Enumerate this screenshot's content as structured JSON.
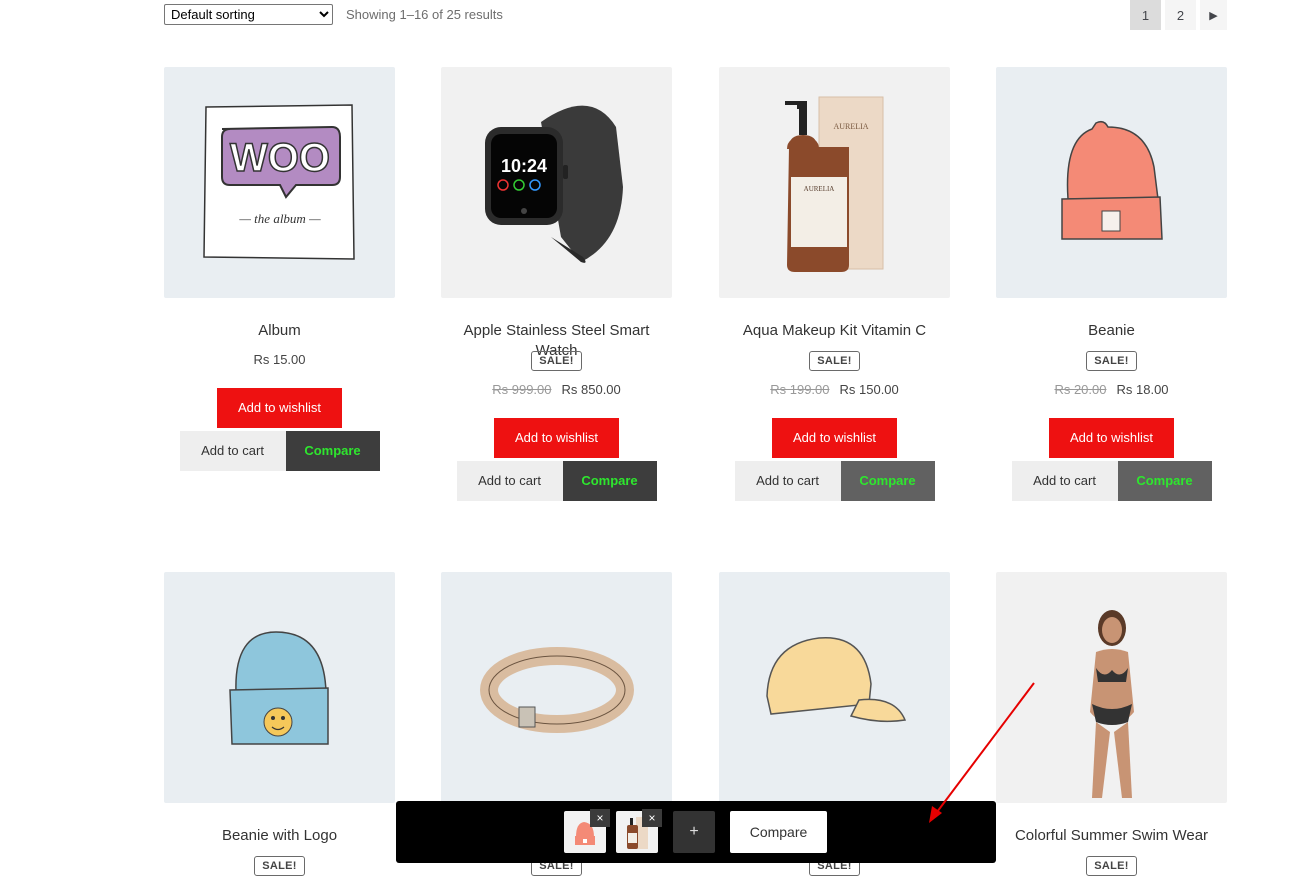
{
  "toolbar": {
    "sort_selected": "Default sorting",
    "result_count": "Showing 1–16 of 25 results",
    "pages": [
      "1",
      "2"
    ],
    "current_page": "1",
    "next_icon": "caret-right-icon"
  },
  "products": [
    {
      "title": "Album",
      "sale": false,
      "price": "Rs 15.00",
      "wishlist": "Add to wishlist",
      "cart": "Add to cart",
      "compare": "Compare"
    },
    {
      "title": "Apple Stainless Steel Smart Watch",
      "sale": true,
      "sale_label": "SALE!",
      "old_price": "Rs 999.00",
      "price": "Rs 850.00",
      "wishlist": "Add to wishlist",
      "cart": "Add to cart",
      "compare": "Compare"
    },
    {
      "title": "Aqua Makeup Kit Vitamin C",
      "sale": true,
      "sale_label": "SALE!",
      "old_price": "Rs 199.00",
      "price": "Rs 150.00",
      "wishlist": "Add to wishlist",
      "cart": "Add to cart",
      "compare": "Compare"
    },
    {
      "title": "Beanie",
      "sale": true,
      "sale_label": "SALE!",
      "old_price": "Rs 20.00",
      "price": "Rs 18.00",
      "wishlist": "Add to wishlist",
      "cart": "Add to cart",
      "compare": "Compare"
    },
    {
      "title": "Beanie with Logo",
      "sale": true,
      "sale_label": "SALE!"
    },
    {
      "title": "",
      "sale": true,
      "sale_label": "SALE!"
    },
    {
      "title": "",
      "sale": true,
      "sale_label": "SALE!"
    },
    {
      "title": "Colorful Summer Swim Wear",
      "sale": true,
      "sale_label": "SALE!"
    }
  ],
  "compare_bar": {
    "remove_symbol": "×",
    "add_symbol": "+",
    "compare_label": "Compare"
  },
  "colors": {
    "wishlist_bg": "#ee1111",
    "compare_bg": "#3d3d3d",
    "compare_text": "#2ee62e",
    "annotation_arrow": "#e60000"
  }
}
